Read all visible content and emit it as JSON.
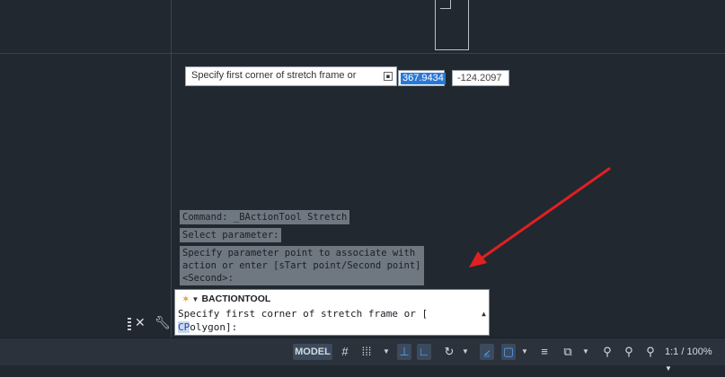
{
  "dynamic_input": {
    "prompt": "Specify first corner of stretch frame or",
    "x_value": "367.9434",
    "y_value": "-124.2097"
  },
  "command_history": [
    "Command: _BActionTool Stretch",
    "Select parameter:",
    "Specify parameter point to associate with\naction or enter [sTart point/Second point]\n<Second>:"
  ],
  "command_line": {
    "command_name": "BACTIONTOOL",
    "prompt_part1": "Specify first corner of stretch frame or [",
    "option_highlight": "CP",
    "option_rest": "olygon",
    "prompt_part2": "]:"
  },
  "status_bar": {
    "model_label": "MODEL",
    "scale_label": "1:1 / 100%",
    "icons": [
      "grid-icon",
      "snap-icon",
      "ortho-icon",
      "polar-icon",
      "isodraft-icon",
      "osnap-track-icon",
      "object-snap-icon",
      "lineweight-icon",
      "transparency-icon",
      "annotation-visibility-icon",
      "annotation-autoscale-icon",
      "annotation-scale-icon"
    ]
  },
  "colors": {
    "canvas": "#212830",
    "highlight": "#2a78d6",
    "arrow": "#e02020",
    "active_blue": "#54a6ff"
  }
}
